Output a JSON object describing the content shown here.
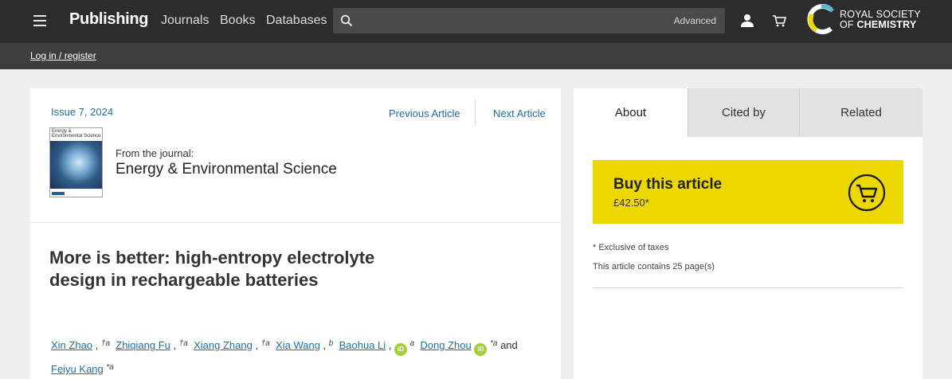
{
  "header": {
    "brand": "Publishing",
    "nav": [
      "Journals",
      "Books",
      "Databases"
    ],
    "search_placeholder": "",
    "advanced": "Advanced",
    "logo_line1": "ROYAL SOCIETY",
    "logo_line2_of": "OF ",
    "logo_line2_chem": "CHEMISTRY"
  },
  "subbar": {
    "login": "Log in / register"
  },
  "article": {
    "issue": "Issue 7, 2024",
    "prev": "Previous Article",
    "next": "Next Article",
    "cover_title": "Energy & Environmental Science",
    "from_label": "From the journal:",
    "journal": "Energy & Environmental Science",
    "title": "More is better: high-entropy electrolyte design in rechargeable batteries",
    "authors": [
      {
        "name": "Xin Zhao",
        "sup": "†a"
      },
      {
        "name": "Zhiqiang Fu",
        "sup": "†a"
      },
      {
        "name": "Xiang Zhang",
        "sup": "†a"
      },
      {
        "name": "Xia Wang",
        "sup": "b"
      },
      {
        "name": "Baohua Li",
        "sup": "a"
      },
      {
        "name": "Dong Zhou",
        "sup": "*a"
      },
      {
        "name": "Feiyu Kang",
        "sup": "*a"
      }
    ],
    "and": "and",
    "orcid": "iD"
  },
  "sidebar": {
    "tabs": [
      "About",
      "Cited by",
      "Related"
    ],
    "buy_title": "Buy this article",
    "buy_price": "£42.50*",
    "tax_note": "* Exclusive of taxes",
    "pages_note": "This article contains 25 page(s)"
  },
  "colors": {
    "topbar": "#2c2c2c",
    "link": "#1f6ea6",
    "buy": "#ecd800",
    "orcid": "#a6ce39"
  }
}
